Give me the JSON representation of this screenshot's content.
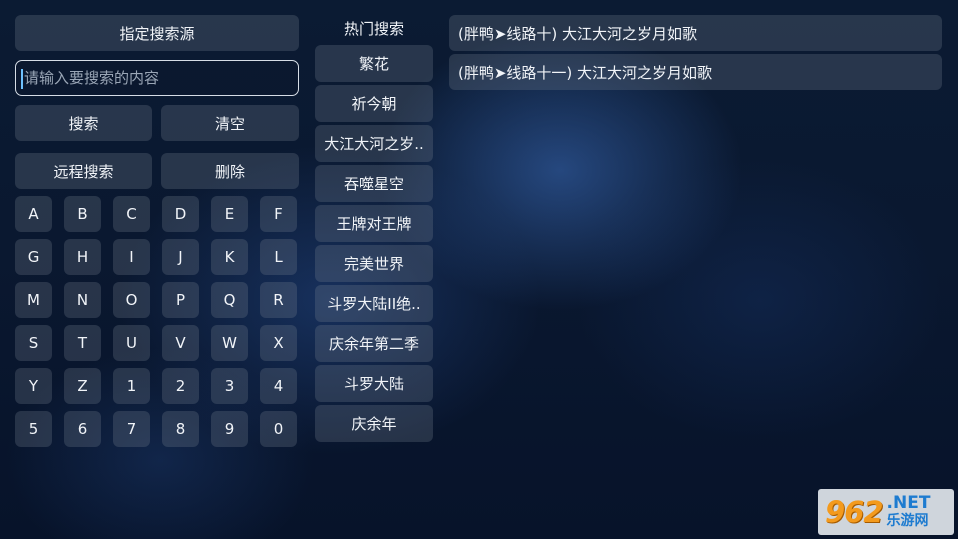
{
  "left_panel": {
    "source_button": "指定搜索源",
    "search_placeholder": "请输入要搜索的内容",
    "search_value": "",
    "search_button": "搜索",
    "clear_button": "清空",
    "remote_button": "远程搜索",
    "delete_button": "删除",
    "keys": [
      "A",
      "B",
      "C",
      "D",
      "E",
      "F",
      "G",
      "H",
      "I",
      "J",
      "K",
      "L",
      "M",
      "N",
      "O",
      "P",
      "Q",
      "R",
      "S",
      "T",
      "U",
      "V",
      "W",
      "X",
      "Y",
      "Z",
      "1",
      "2",
      "3",
      "4",
      "5",
      "6",
      "7",
      "8",
      "9",
      "0"
    ]
  },
  "hot": {
    "title": "热门搜索",
    "items": [
      "繁花",
      "祈今朝",
      "大江大河之岁..",
      "吞噬星空",
      "王牌对王牌",
      "完美世界",
      "斗罗大陆II绝..",
      "庆余年第二季",
      "斗罗大陆",
      "庆余年"
    ]
  },
  "results": [
    "(胖鸭➤线路十)  大江大河之岁月如歌",
    "(胖鸭➤线路十一)  大江大河之岁月如歌"
  ],
  "watermark": {
    "mark": "962",
    "net": ".NET",
    "cn": "乐游网"
  }
}
